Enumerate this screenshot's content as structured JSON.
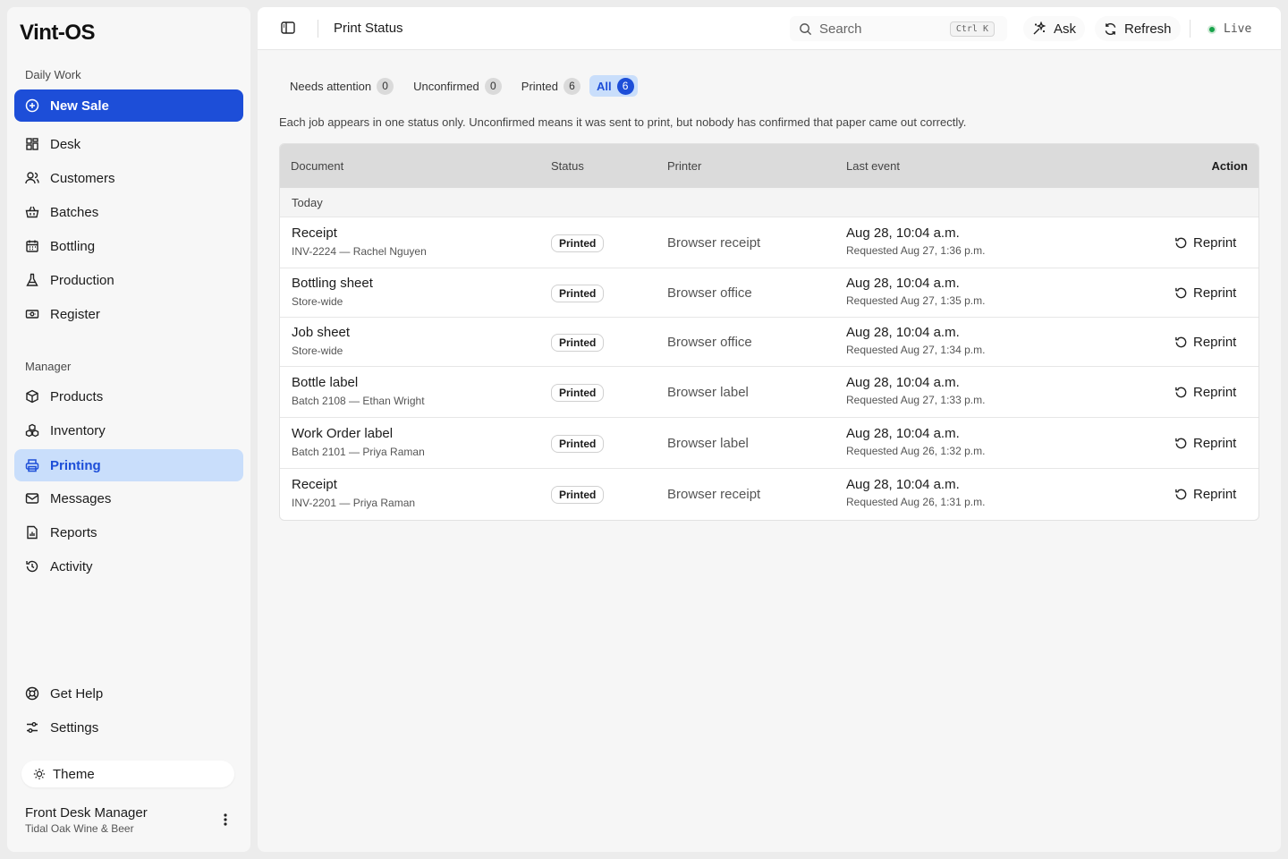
{
  "app": {
    "logo_text": "Vint-OS"
  },
  "sidebar": {
    "section_daily": "Daily Work",
    "new_sale": "New Sale",
    "daily_items": [
      {
        "label": "Desk",
        "icon": "grid-icon"
      },
      {
        "label": "Customers",
        "icon": "users-icon"
      },
      {
        "label": "Batches",
        "icon": "basket-icon"
      },
      {
        "label": "Bottling",
        "icon": "calendar-icon"
      },
      {
        "label": "Production",
        "icon": "flask-icon"
      },
      {
        "label": "Register",
        "icon": "register-icon"
      }
    ],
    "section_manager": "Manager",
    "manager_items": [
      {
        "label": "Products",
        "icon": "box-icon"
      },
      {
        "label": "Inventory",
        "icon": "boxes-icon"
      },
      {
        "label": "Printing",
        "icon": "printer-icon",
        "active": true
      },
      {
        "label": "Messages",
        "icon": "mail-icon"
      },
      {
        "label": "Reports",
        "icon": "report-icon"
      },
      {
        "label": "Activity",
        "icon": "history-icon"
      }
    ],
    "help": "Get Help",
    "settings": "Settings",
    "theme": "Theme",
    "user": {
      "name": "Front Desk Manager",
      "org": "Tidal Oak Wine & Beer"
    }
  },
  "topbar": {
    "title": "Print Status",
    "search_placeholder": "Search",
    "search_shortcut": "Ctrl K",
    "ask": "Ask",
    "refresh": "Refresh",
    "live": "Live"
  },
  "filters": [
    {
      "label": "Needs attention",
      "count": "0"
    },
    {
      "label": "Unconfirmed",
      "count": "0"
    },
    {
      "label": "Printed",
      "count": "6"
    },
    {
      "label": "All",
      "count": "6",
      "selected": true
    }
  ],
  "help_text": "Each job appears in one status only. Unconfirmed means it was sent to print, but nobody has confirmed that paper came out correctly.",
  "table": {
    "headers": {
      "document": "Document",
      "status": "Status",
      "printer": "Printer",
      "last_event": "Last event",
      "action": "Action"
    },
    "group_label": "Today",
    "rows": [
      {
        "doc": "Receipt",
        "sub": "INV-2224 — Rachel Nguyen",
        "status": "Printed",
        "printer": "Browser receipt",
        "event": "Aug 28, 10:04 a.m.",
        "requested": "Requested Aug 27, 1:36 p.m.",
        "action": "Reprint"
      },
      {
        "doc": "Bottling sheet",
        "sub": "Store-wide",
        "status": "Printed",
        "printer": "Browser office",
        "event": "Aug 28, 10:04 a.m.",
        "requested": "Requested Aug 27, 1:35 p.m.",
        "action": "Reprint"
      },
      {
        "doc": "Job sheet",
        "sub": "Store-wide",
        "status": "Printed",
        "printer": "Browser office",
        "event": "Aug 28, 10:04 a.m.",
        "requested": "Requested Aug 27, 1:34 p.m.",
        "action": "Reprint"
      },
      {
        "doc": "Bottle label",
        "sub": "Batch 2108 — Ethan Wright",
        "status": "Printed",
        "printer": "Browser label",
        "event": "Aug 28, 10:04 a.m.",
        "requested": "Requested Aug 27, 1:33 p.m.",
        "action": "Reprint"
      },
      {
        "doc": "Work Order label",
        "sub": "Batch 2101 — Priya Raman",
        "status": "Printed",
        "printer": "Browser label",
        "event": "Aug 28, 10:04 a.m.",
        "requested": "Requested Aug 26, 1:32 p.m.",
        "action": "Reprint"
      },
      {
        "doc": "Receipt",
        "sub": "INV-2201 — Priya Raman",
        "status": "Printed",
        "printer": "Browser receipt",
        "event": "Aug 28, 10:04 a.m.",
        "requested": "Requested Aug 26, 1:31 p.m.",
        "action": "Reprint"
      }
    ]
  },
  "colors": {
    "accent": "#1d4ed8",
    "active_bg": "#c9defb",
    "live": "#16a34a"
  }
}
